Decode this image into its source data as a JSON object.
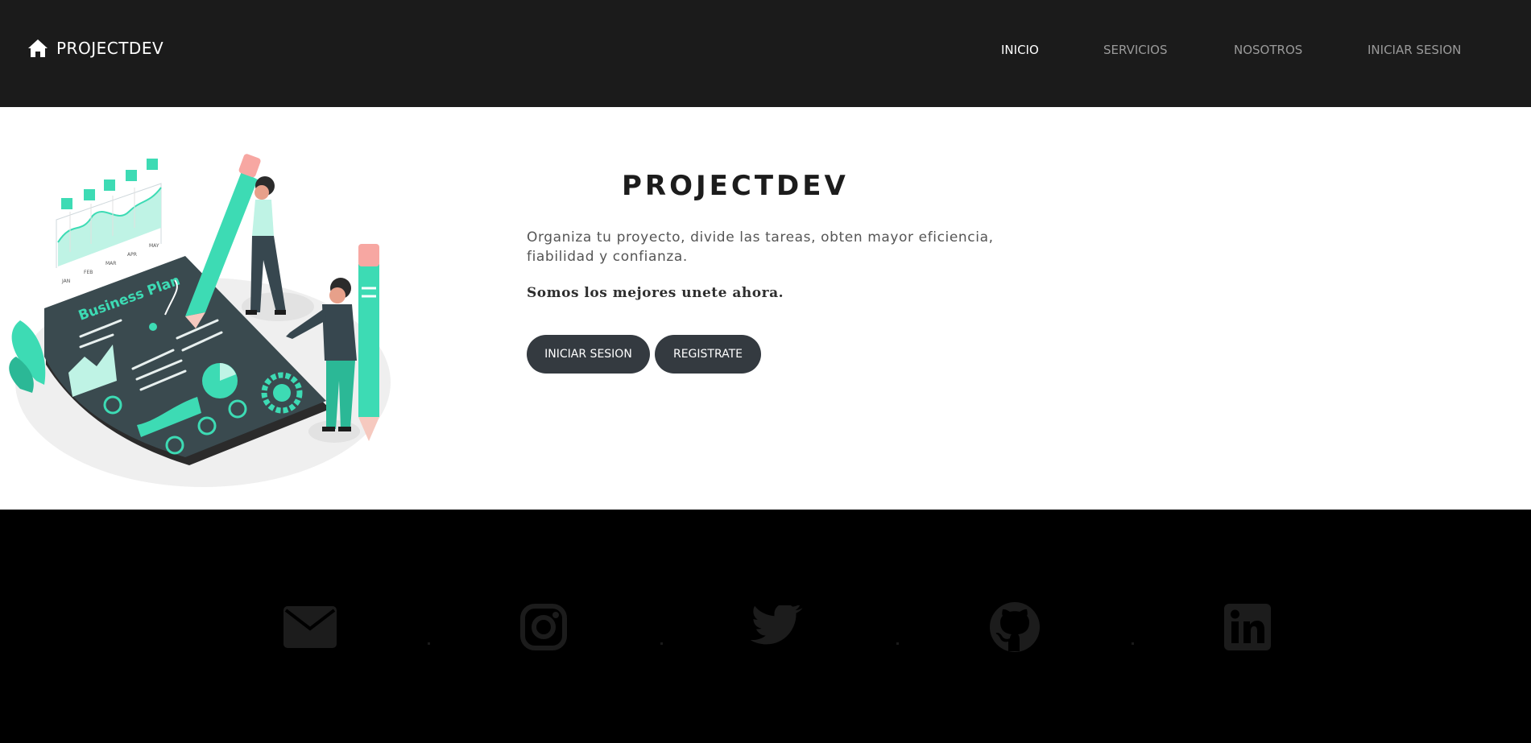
{
  "navbar": {
    "brand": "PROJECTDEV",
    "brand_icon": "home-icon",
    "links": [
      {
        "label": "INICIO",
        "active": true
      },
      {
        "label": "SERVICIOS",
        "active": false
      },
      {
        "label": "NOSOTROS",
        "active": false
      },
      {
        "label": "INICIAR SESION",
        "active": false
      }
    ]
  },
  "hero": {
    "illustration_text": "Business Plan",
    "illustration_months": [
      "JAN",
      "FEB",
      "MAR",
      "APR",
      "MAY"
    ],
    "title": "PROJECTDEV",
    "description": "Organiza tu proyecto, divide las tareas, obten mayor eficiencia, fiabilidad y confianza.",
    "tagline": "Somos los mejores unete ahora.",
    "buttons": {
      "login": "INICIAR SESION",
      "register": "REGISTRATE"
    }
  },
  "footer": {
    "icons": [
      "email-icon",
      "instagram-icon",
      "twitter-icon",
      "github-icon",
      "linkedin-icon"
    ]
  },
  "colors": {
    "navbar_bg": "#1b1b1b",
    "accent": "#3ddbb4",
    "button_bg": "#343a40",
    "footer_bg": "#000000",
    "footer_icon": "#1c1c1c"
  }
}
